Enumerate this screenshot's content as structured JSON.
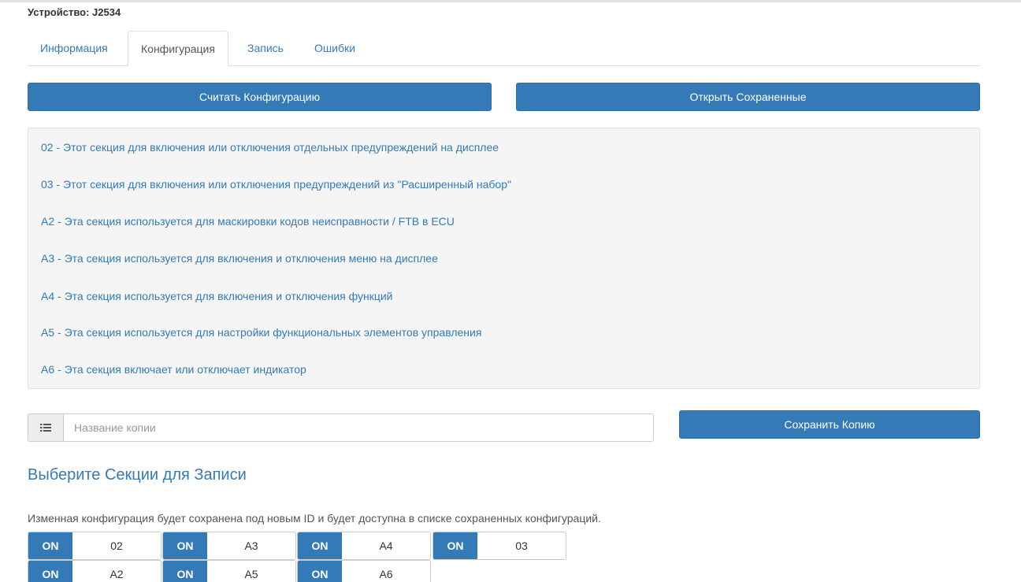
{
  "device": {
    "label": "Устройство: J2534"
  },
  "tabs": [
    {
      "label": "Информация"
    },
    {
      "label": "Конфигурация",
      "active": true
    },
    {
      "label": "Запись"
    },
    {
      "label": "Ошибки"
    }
  ],
  "buttons": {
    "read_config": "Считать Конфигурацию",
    "open_saved": "Открыть Сохраненные",
    "save_copy": "Сохранить Копию"
  },
  "sections": [
    "02 - Этот секция для включения или отключения отдельных предупреждений на дисплее",
    "03 - Этот секция для включения или отключения предупреждений из \"Расширенный набор\"",
    "A2 - Эта секция используется для маскировки кодов неисправности / FTB в ECU",
    "A3 - Эта секция используется для включения и отключения меню на дисплее",
    "A4 - Эта секция используется для включения и отключения функций",
    "A5 - Эта секция используется для настройки функциональных элементов управления",
    "A6 - Эта секция включает или отключает индикатор"
  ],
  "copy": {
    "placeholder": "Название копии",
    "value": ""
  },
  "write": {
    "title": "Выберите Секции для Записи",
    "help": "Изменная конфигурация будет сохранена под новым ID и будет доступна в списке сохраненных конфигураций."
  },
  "toggles": [
    {
      "state": "ON",
      "label": "02"
    },
    {
      "state": "ON",
      "label": "A3"
    },
    {
      "state": "ON",
      "label": "A4"
    },
    {
      "state": "ON",
      "label": "03"
    },
    {
      "state": "ON",
      "label": "A2"
    },
    {
      "state": "ON",
      "label": "A5"
    },
    {
      "state": "ON",
      "label": "A6"
    }
  ],
  "colors": {
    "primary": "#337ab7",
    "link": "#337ab7",
    "well": "#f5f5f5",
    "border": "#dddddd"
  },
  "icons": {
    "input_addon": "list-icon"
  }
}
